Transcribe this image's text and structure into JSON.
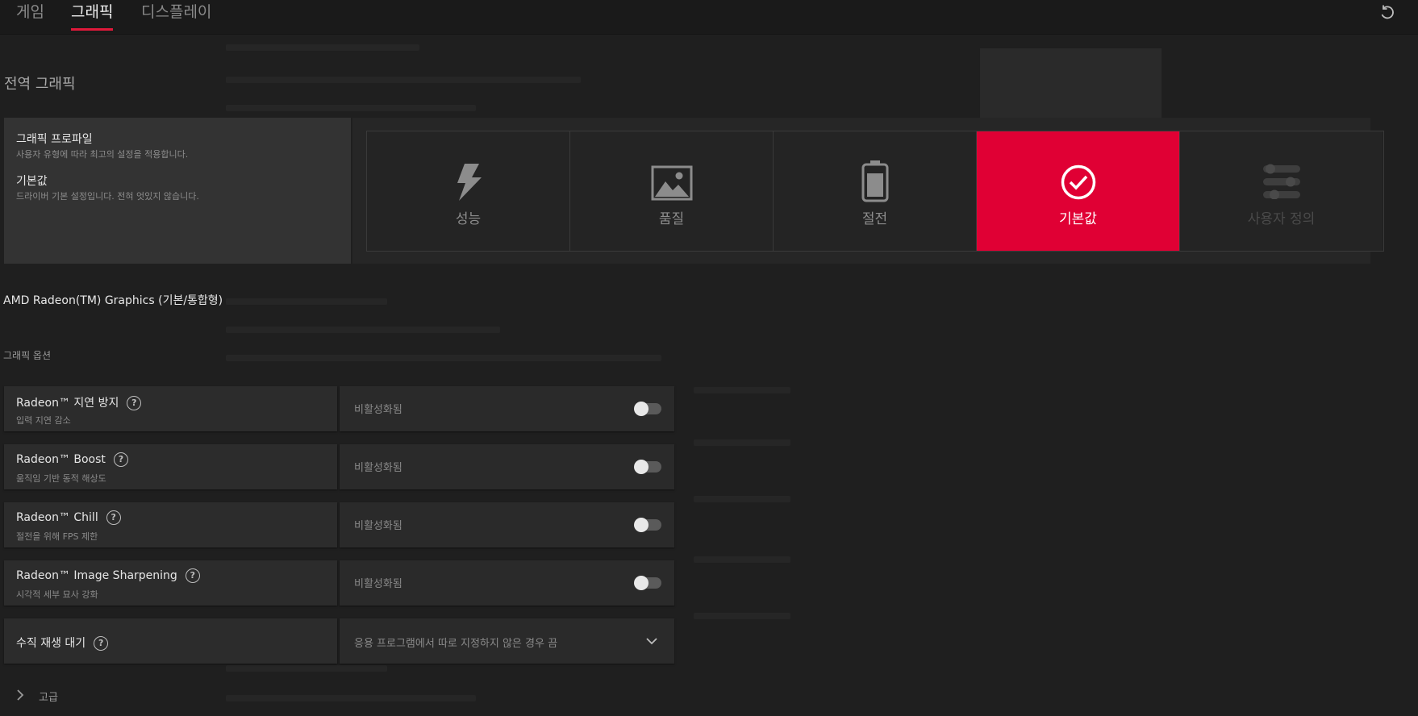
{
  "tabs": [
    {
      "label": "게임"
    },
    {
      "label": "그래픽"
    },
    {
      "label": "디스플레이"
    }
  ],
  "active_tab": "그래픽",
  "section_title": "전역 그래픽",
  "profile": {
    "heading": "그래픽 프로파일",
    "heading_sub": "사용자 유형에 따라 최고의 설정을 적용합니다.",
    "current": "기본값",
    "current_sub": "드라이버 기본 설정입니다. 전혀 엇있지 않습니다.",
    "cards": [
      {
        "label": "성능",
        "icon": "lightning-icon"
      },
      {
        "label": "품질",
        "icon": "image-icon"
      },
      {
        "label": "절전",
        "icon": "battery-icon"
      },
      {
        "label": "기본값",
        "icon": "checkmark-circle-icon",
        "active": true
      },
      {
        "label": "사용자 정의",
        "icon": "sliders-icon",
        "disabled": true
      }
    ]
  },
  "gpu_name": "AMD Radeon(TM) Graphics (기본/통합형)",
  "options_title": "그래픽 옵션",
  "options": [
    {
      "name": "Radeon™ 지연 방지",
      "sub": "입력 지연 감소",
      "state": "비활성화됨"
    },
    {
      "name": "Radeon™ Boost",
      "sub": "움직임 기반 동적 해상도",
      "state": "비활성화됨"
    },
    {
      "name": "Radeon™ Chill",
      "sub": "절전을 위해 FPS 제한",
      "state": "비활성화됨"
    },
    {
      "name": "Radeon™ Image Sharpening",
      "sub": "시각적 세부 묘사 강화",
      "state": "비활성화됨"
    }
  ],
  "vsync": {
    "name": "수직 재생 대기",
    "value": "응용 프로그램에서 따로 지정하지 않은 경우 끔"
  },
  "advanced_label": "고급",
  "help_glyph": "?",
  "colors": {
    "accent": "#e00034",
    "background": "#1f1f1f",
    "panel": "#2c2c2c"
  }
}
